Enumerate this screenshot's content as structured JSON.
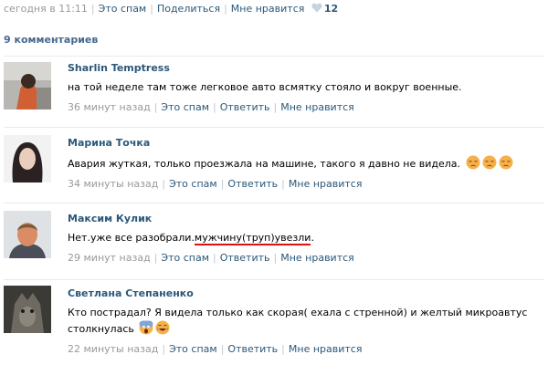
{
  "post_bar": {
    "time": "сегодня в 11:11",
    "spam": "Это спам",
    "share": "Поделиться",
    "like": "Мне нравится",
    "likes_count": "12"
  },
  "comments_count": "9 комментариев",
  "comments": [
    {
      "author": "Sharlin Temptress",
      "text": "на той неделе там тоже легковое авто всмятку стояло и вокруг военные.",
      "time": "36 минут назад",
      "spam": "Это спам",
      "reply": "Ответить",
      "like": "Мне нравится"
    },
    {
      "author": "Марина Точка",
      "text": "Авария жуткая, только проезжала на машине, такого я давно не видела.",
      "emoji": [
        "pensive-face-icon",
        "pensive-face-icon",
        "pensive-face-icon"
      ],
      "time": "34 минуты назад",
      "spam": "Это спам",
      "reply": "Ответить",
      "like": "Мне нравится"
    },
    {
      "author": "Максим Кулик",
      "text_prefix": "Нет.уже все разобрали.",
      "text_underlined": "мужчину(труп)увезли",
      "text_suffix": ".",
      "time": "29 минут назад",
      "spam": "Это спам",
      "reply": "Ответить",
      "like": "Мне нравится"
    },
    {
      "author": "Светлана Степаненко",
      "text": "Кто пострадал? Я видела только как скорая( ехала с стренной) и желтый микроавтус столкнулась",
      "emoji": [
        "screaming-face-icon",
        "crying-face-icon"
      ],
      "time": "22 минуты назад",
      "spam": "Это спам",
      "reply": "Ответить",
      "like": "Мне нравится"
    }
  ],
  "colors": {
    "link": "#2b587a",
    "header": "#45688e",
    "meta": "#999999",
    "underline": "#dd1111",
    "heart": "#c6d3e0"
  }
}
